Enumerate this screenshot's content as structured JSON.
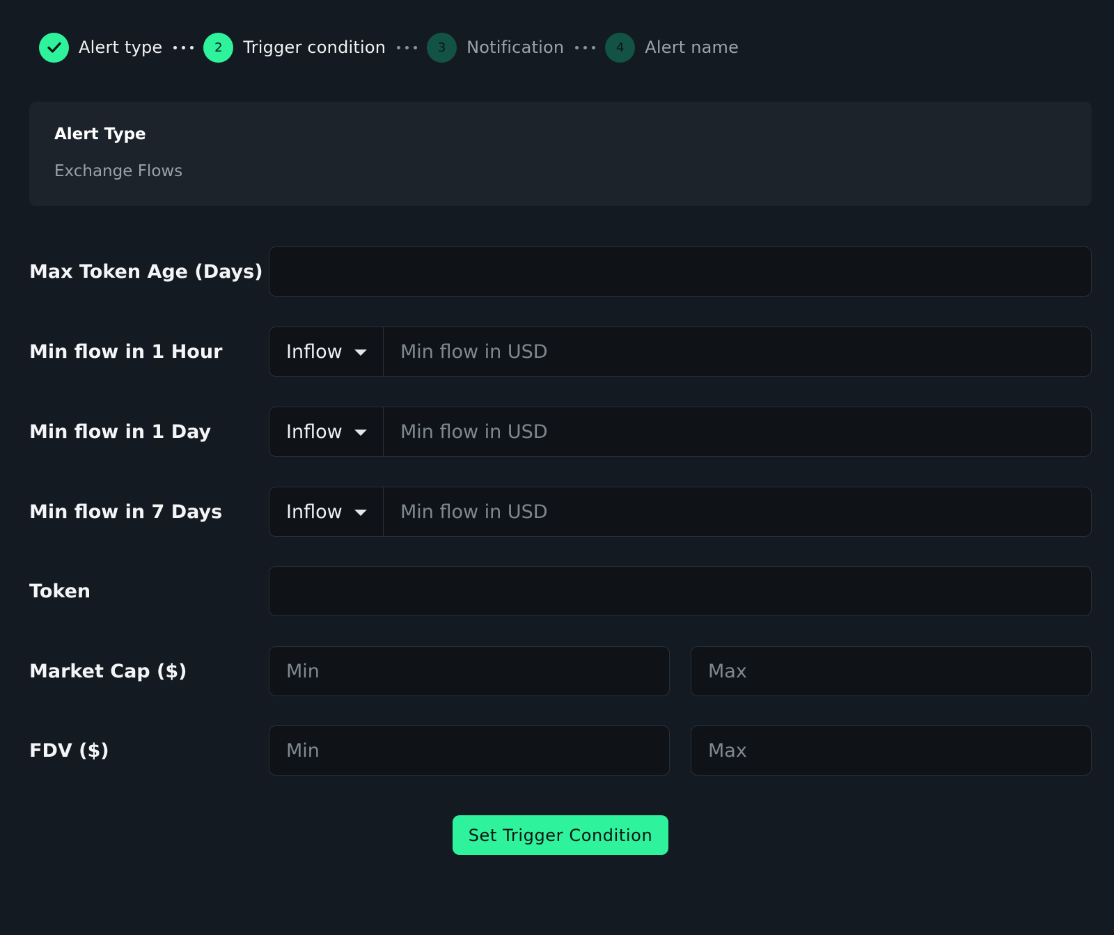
{
  "stepper": {
    "steps": [
      {
        "label": "Alert type",
        "status": "done",
        "icon": "check-icon"
      },
      {
        "number": "2",
        "label": "Trigger condition",
        "status": "active"
      },
      {
        "number": "3",
        "label": "Notification",
        "status": "pending"
      },
      {
        "number": "4",
        "label": "Alert name",
        "status": "pending"
      }
    ]
  },
  "alert_type": {
    "title": "Alert Type",
    "value": "Exchange Flows"
  },
  "form": {
    "max_token_age": {
      "label": "Max Token Age (Days)",
      "value": "",
      "placeholder": ""
    },
    "flow_1h": {
      "label": "Min flow in 1 Hour",
      "direction": "Inflow",
      "placeholder": "Min flow in USD",
      "value": ""
    },
    "flow_1d": {
      "label": "Min flow in 1 Day",
      "direction": "Inflow",
      "placeholder": "Min flow in USD",
      "value": ""
    },
    "flow_7d": {
      "label": "Min flow in 7 Days",
      "direction": "Inflow",
      "placeholder": "Min flow in USD",
      "value": ""
    },
    "token": {
      "label": "Token",
      "value": "",
      "placeholder": ""
    },
    "market_cap": {
      "label": "Market Cap ($)",
      "min_placeholder": "Min",
      "max_placeholder": "Max"
    },
    "fdv": {
      "label": "FDV ($)",
      "min_placeholder": "Min",
      "max_placeholder": "Max"
    }
  },
  "submit": {
    "label": "Set Trigger Condition"
  },
  "colors": {
    "background": "#141a21",
    "card": "#1d232b",
    "input": "#0f1318",
    "accent": "#2ef29c",
    "pending_step": "#135346"
  }
}
